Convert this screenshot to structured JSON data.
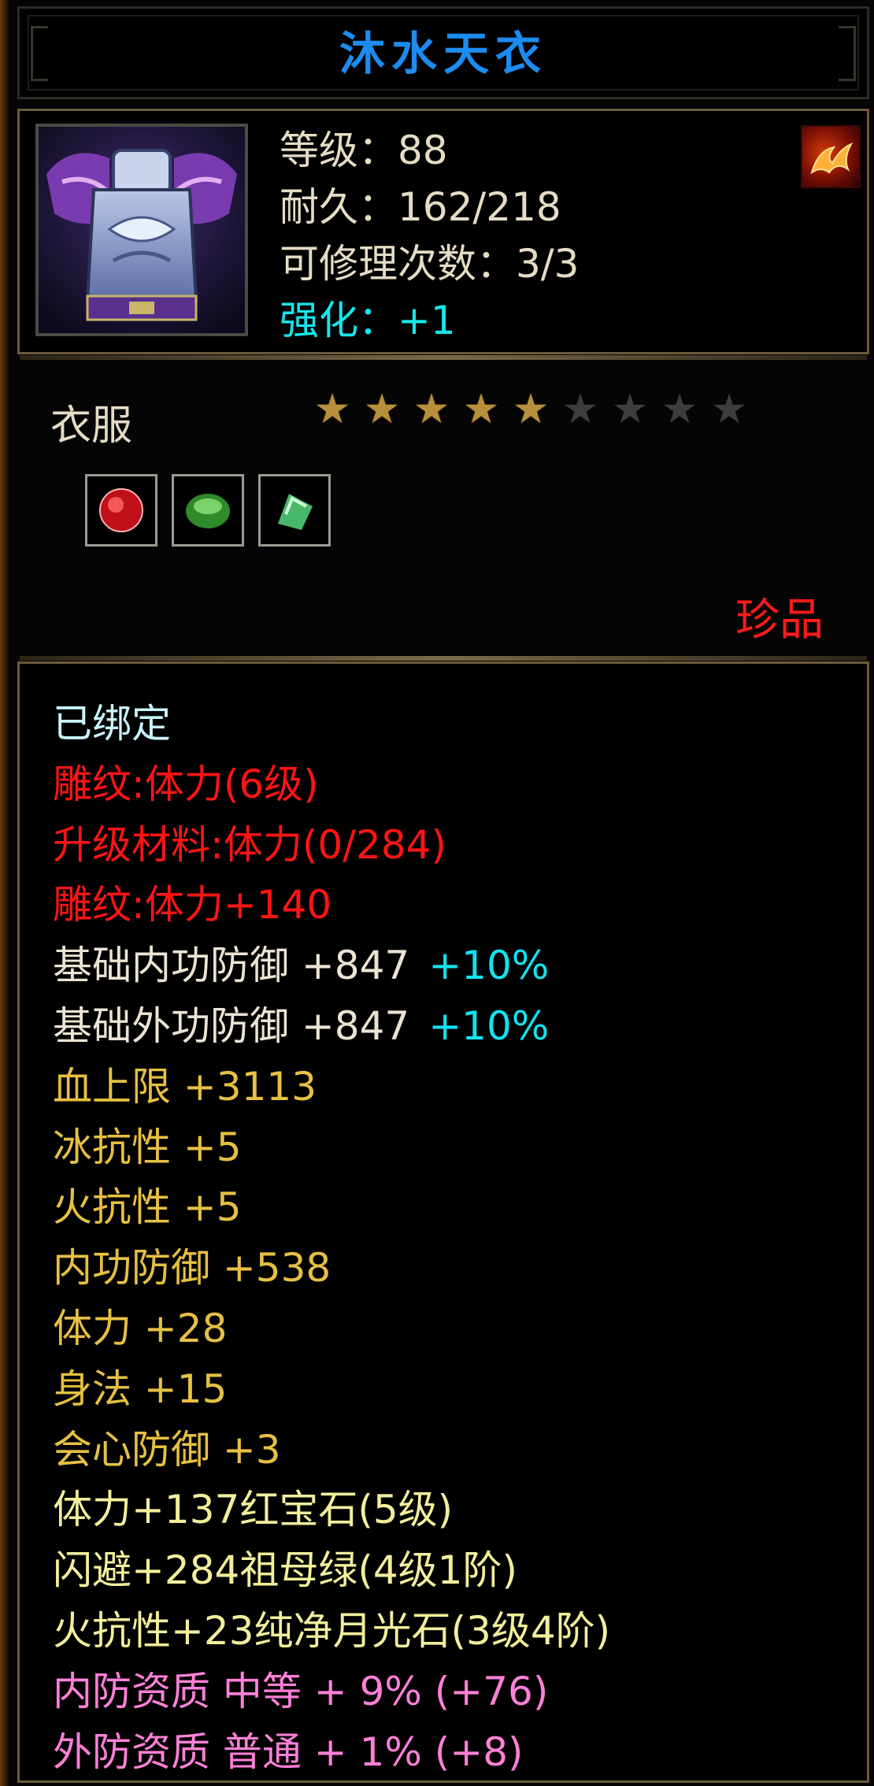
{
  "title": "沐水天衣",
  "header": {
    "level": "等级：88",
    "durability": "耐久：162/218",
    "repairs": "可修理次数：3/3",
    "enhance": "强化：+1",
    "fire_icon": "fire-rune-icon"
  },
  "item_type": "衣服",
  "stars": {
    "filled": 5,
    "total": 9
  },
  "gems": [
    "ruby-gem-icon",
    "emerald-gem-icon",
    "moonstone-gem-icon"
  ],
  "rarity": "珍品",
  "attributes": {
    "bound": "已绑定",
    "engrave": "雕纹:体力(6级)",
    "upgrade": "升级材料:体力(0/284)",
    "engrave_bonus": "雕纹:体力+140",
    "inner_def_base": "基础内功防御  +847",
    "inner_def_pct": "+10%",
    "outer_def_base": "基础外功防御  +847",
    "outer_def_pct": "+10%",
    "hp": "血上限  +3113",
    "ice_res": "冰抗性  +5",
    "fire_res": "火抗性  +5",
    "inner_def": "内功防御  +538",
    "stamina": "体力  +28",
    "agility": "身法  +15",
    "crit_def": "会心防御  +3",
    "gem1": "体力+137红宝石(5级)",
    "gem2": "闪避+284祖母绿(4级1阶)",
    "gem3": "火抗性+23纯净月光石(3级4阶)",
    "quality_inner": "内防资质  中等  + 9% (+76)",
    "quality_outer": "外防资质  普通  + 1% (+8)"
  },
  "colors": {
    "title": "#1c8cf0",
    "cyan": "#17e6ec",
    "red": "#ff1414",
    "gold": "#e6c042",
    "pink": "#ff80d8"
  }
}
